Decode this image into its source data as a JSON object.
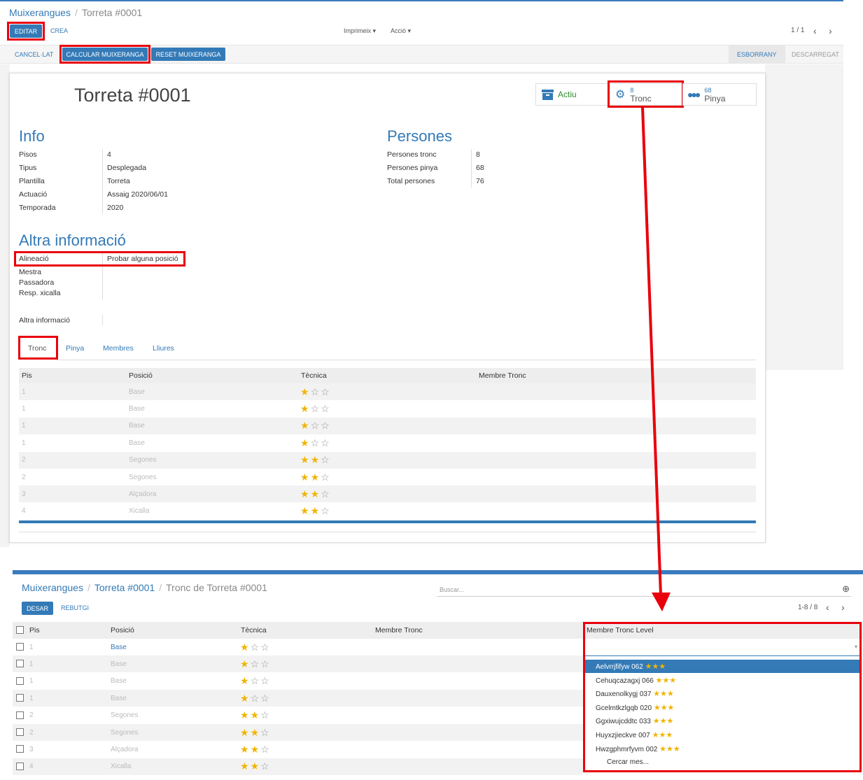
{
  "top": {
    "breadcrumb": {
      "root": "Muixerangues",
      "current": "Torreta #0001"
    },
    "buttons": {
      "edit": "Editar",
      "create": "Crea",
      "cancel": "Cancel·lat",
      "calc": "Calcular Muixeranga",
      "reset": "Reset Muixeranga"
    },
    "dropdowns": {
      "print": "Imprimeix",
      "action": "Acció"
    },
    "pager": "1 / 1",
    "status": {
      "draft": "Esborrany",
      "downloaded": "Descarregat"
    },
    "title": "Torreta #0001",
    "smart": {
      "active": "Actiu",
      "tronc_count": "8",
      "tronc_label": "Tronc",
      "pinya_count": "68",
      "pinya_label": "Pinya"
    },
    "info": {
      "heading": "Info",
      "pisos_l": "Pisos",
      "pisos_v": "4",
      "tipus_l": "Tipus",
      "tipus_v": "Desplegada",
      "plantilla_l": "Plantilla",
      "plantilla_v": "Torreta",
      "actuacio_l": "Actuació",
      "actuacio_v": "Assaig 2020/06/01",
      "temporada_l": "Temporada",
      "temporada_v": "2020"
    },
    "persones": {
      "heading": "Persones",
      "tronc_l": "Persones tronc",
      "tronc_v": "8",
      "pinya_l": "Persones pinya",
      "pinya_v": "68",
      "total_l": "Total persones",
      "total_v": "76"
    },
    "altra": {
      "heading": "Altra informació",
      "alineacio_l": "Alineació",
      "alineacio_v": "Probar alguna posició",
      "mestra_l": "Mestra",
      "passadora_l": "Passadora",
      "resp_l": "Resp. xicalla",
      "altra_l": "Altra informació"
    },
    "tabs": [
      "Tronc",
      "Pinya",
      "Membres",
      "Lliures"
    ],
    "table_headers": [
      "Pis",
      "Posició",
      "Tècnica",
      "Membre Tronc"
    ],
    "rows": [
      {
        "pis": "1",
        "pos": "Base",
        "stars": 1
      },
      {
        "pis": "1",
        "pos": "Base",
        "stars": 1
      },
      {
        "pis": "1",
        "pos": "Base",
        "stars": 1
      },
      {
        "pis": "1",
        "pos": "Base",
        "stars": 1
      },
      {
        "pis": "2",
        "pos": "Segones",
        "stars": 2
      },
      {
        "pis": "2",
        "pos": "Segones",
        "stars": 2
      },
      {
        "pis": "3",
        "pos": "Alçadora",
        "stars": 2
      },
      {
        "pis": "4",
        "pos": "Xicalla",
        "stars": 2
      }
    ]
  },
  "bottom": {
    "breadcrumb": {
      "root": "Muixerangues",
      "mid": "Torreta #0001",
      "current": "Tronc de Torreta #0001"
    },
    "search_placeholder": "Buscar...",
    "buttons": {
      "save": "Desar",
      "discard": "Rebutgi"
    },
    "pager": "1-8 / 8",
    "table_headers": [
      "Pis",
      "Posició",
      "Tècnica",
      "Membre Tronc",
      "Membre Tronc Level"
    ],
    "rows": [
      {
        "pis": "1",
        "pos": "Base",
        "stars": 1,
        "active": true
      },
      {
        "pis": "1",
        "pos": "Base",
        "stars": 1
      },
      {
        "pis": "1",
        "pos": "Base",
        "stars": 1
      },
      {
        "pis": "1",
        "pos": "Base",
        "stars": 1
      },
      {
        "pis": "2",
        "pos": "Segones",
        "stars": 2
      },
      {
        "pis": "2",
        "pos": "Segones",
        "stars": 2
      },
      {
        "pis": "3",
        "pos": "Alçadora",
        "stars": 2
      },
      {
        "pis": "4",
        "pos": "Xicalla",
        "stars": 2
      }
    ],
    "options": [
      "Aelvrrjfifyw 062",
      "Cehuqcazagxj 066",
      "Dauxenolkygj 037",
      "Gcelmtkzlgqb 020",
      "Ggxiwujcddtc 033",
      "Huyxzjieckve 007",
      "Hwzgphmrfyvm 002"
    ],
    "option_stars": "★★★",
    "more": "Cercar mes..."
  },
  "colors": {
    "accent": "#337ab7",
    "highlight": "#e8000b",
    "star": "#f0b400"
  }
}
